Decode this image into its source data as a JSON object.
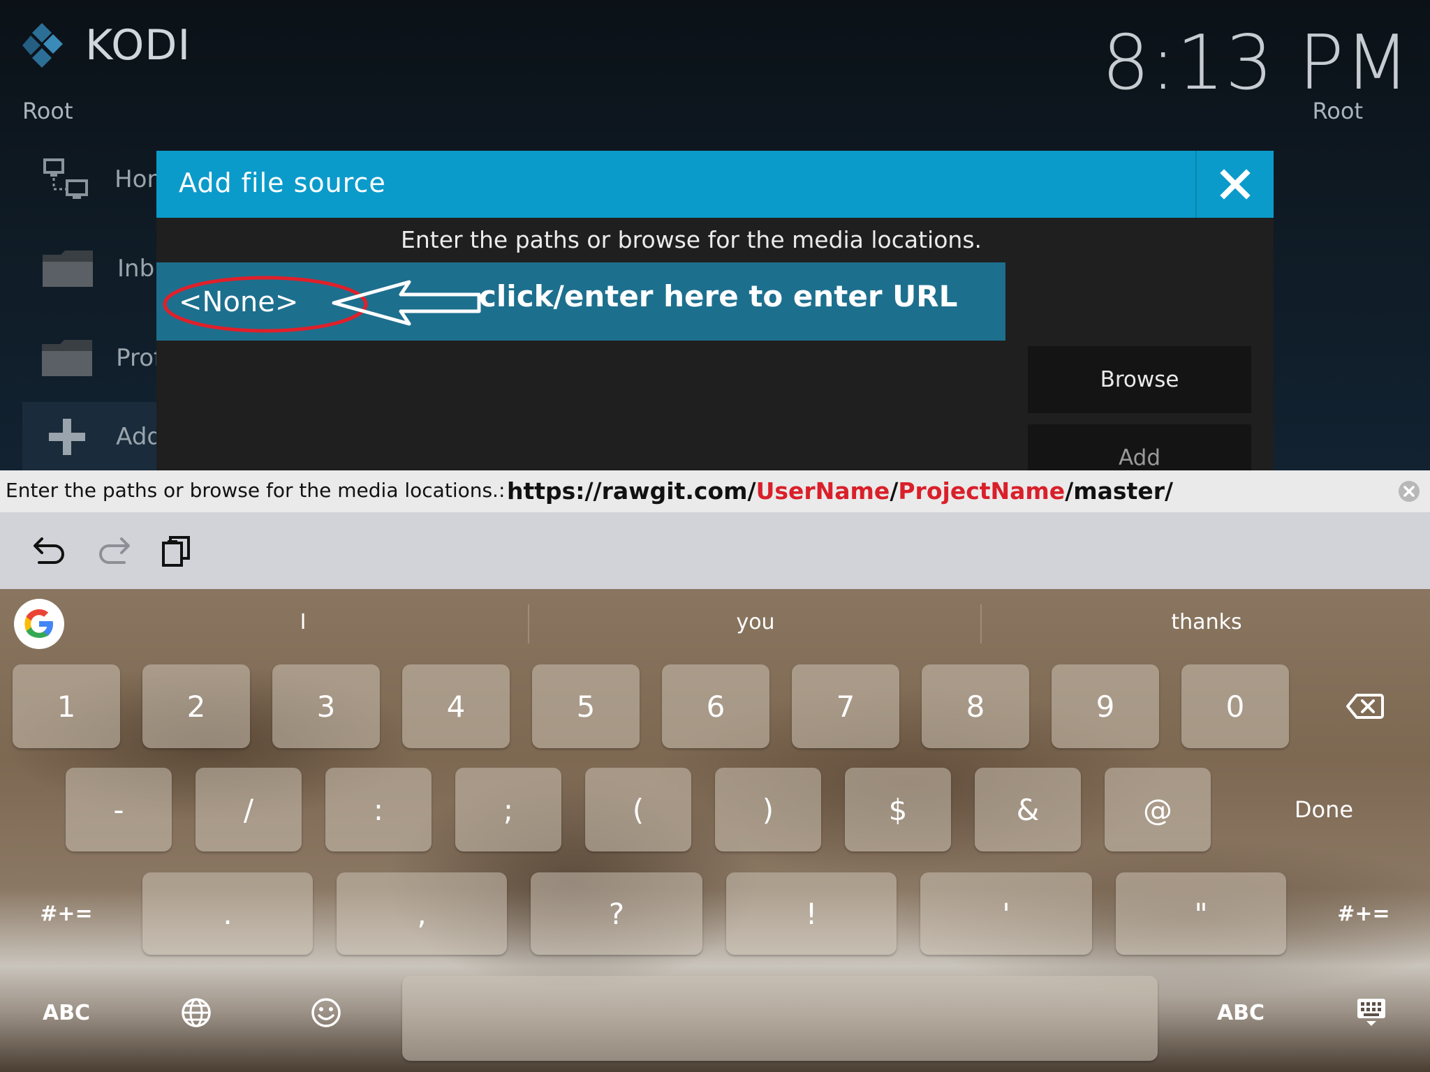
{
  "brand": {
    "app_name": "KODI",
    "root_label_left": "Root",
    "root_label_right": "Root",
    "clock": "8:13 PM",
    "accent_color": "#0b9bcb"
  },
  "sidebar": {
    "items": [
      {
        "label": "Hon",
        "icon": "network-computer-icon"
      },
      {
        "label": "Inb",
        "icon": "folder-icon"
      },
      {
        "label": "Prof",
        "icon": "folder-icon"
      },
      {
        "label": "Add",
        "icon": "plus-icon"
      }
    ]
  },
  "dialog": {
    "title": "Add file source",
    "instruction": "Enter the paths or browse for the media locations.",
    "path_value": "<None>",
    "annotation": "click/enter here to enter URL",
    "browse_label": "Browse",
    "add_label": "Add"
  },
  "input_bar": {
    "label": "Enter the paths or browse for the media locations.:",
    "value_parts": [
      "https://rawgit.com/",
      "UserName",
      "/",
      "ProjectName",
      "/master/"
    ]
  },
  "toolbar": {
    "icons": [
      "undo-icon",
      "redo-icon",
      "clipboard-icon"
    ]
  },
  "keyboard": {
    "suggestions": [
      "I",
      "you",
      "thanks"
    ],
    "row1": [
      "1",
      "2",
      "3",
      "4",
      "5",
      "6",
      "7",
      "8",
      "9",
      "0"
    ],
    "row2": [
      "-",
      "/",
      ":",
      ";",
      "(",
      ")",
      "$",
      "&",
      "@"
    ],
    "row3": [
      ".",
      ",",
      "?",
      "!",
      "'",
      "\""
    ],
    "done_label": "Done",
    "shift_label_left": "#+=",
    "shift_label_right": "#+=",
    "abc_left": "ABC",
    "abc_right": "ABC"
  }
}
